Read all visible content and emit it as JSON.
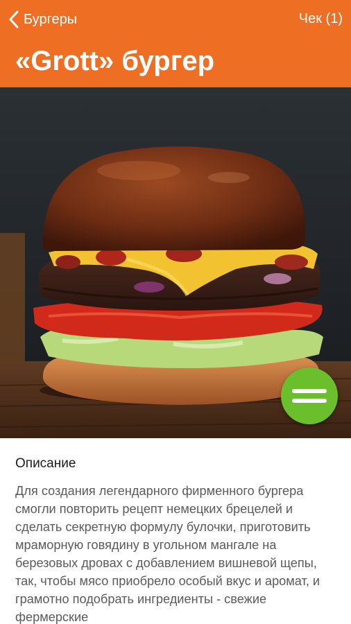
{
  "nav": {
    "back_label": "Бургеры",
    "check_label": "Чек (1)"
  },
  "product": {
    "title": "«Grott» бургер"
  },
  "hero": {
    "image": "burger-photo"
  },
  "fab": {
    "icon": "menu-icon"
  },
  "description": {
    "heading": "Описание",
    "text": "Для создания легендарного фирменного бургера смогли повторить рецепт немецких брецелей и сделать секретную формулу булочки, приготовить мраморную говядину в угольном мангале на березовых дровах с добавлением вишневой щепы, так, чтобы мясо приобрело особый вкус и аромат, и грамотно подобрать ингредиенты - свежие фермерские"
  },
  "colors": {
    "header": "#ee6f24",
    "fab": "#6bbf2c"
  }
}
